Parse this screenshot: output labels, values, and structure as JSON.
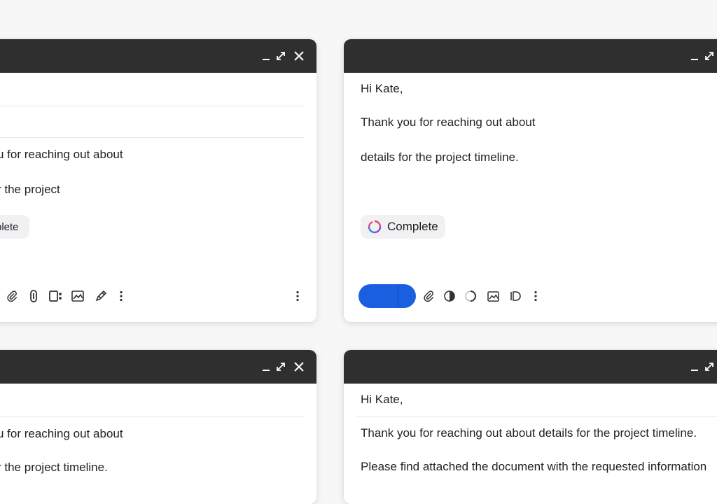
{
  "windows": {
    "top_left": {
      "body_lines": [
        "u for reaching out about",
        "r the project"
      ],
      "chip_label": "plete"
    },
    "top_right": {
      "greeting": "Hi Kate,",
      "body_lines": [
        "Thank you for reaching out about",
        "details for the project timeline."
      ],
      "chip_label": "Complete"
    },
    "bottom_left": {
      "body_lines": [
        "u for reaching out about",
        "r the project timeline."
      ]
    },
    "bottom_right": {
      "greeting": "Hi Kate,",
      "body_lines": [
        "Thank you for reaching out about details for the project timeline.",
        "Please find attached the document with the requested information"
      ]
    }
  },
  "icons": {
    "minimize": "minimize-icon",
    "expand": "expand-icon",
    "close": "close-icon",
    "attach": "paperclip-icon",
    "image": "image-icon",
    "pen": "pen-icon",
    "more": "more-vertical-icon"
  },
  "colors": {
    "titlebar": "#2f2f2f",
    "send_button": "#1a5fe0",
    "chip_background": "#f1f1f3"
  }
}
